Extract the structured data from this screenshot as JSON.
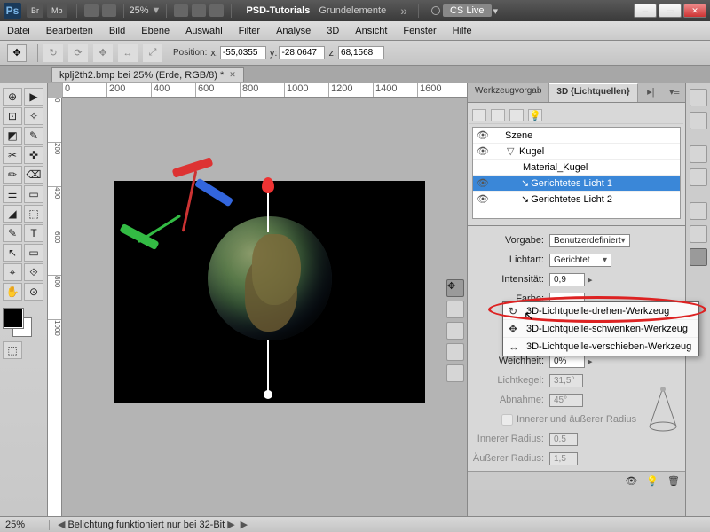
{
  "titlebar": {
    "logo": "Ps",
    "btn_br": "Br",
    "btn_mb": "Mb",
    "zoom": "25%",
    "workspace1": "PSD-Tutorials",
    "workspace2": "Grundelemente",
    "cslive": "CS Live"
  },
  "menu": [
    "Datei",
    "Bearbeiten",
    "Bild",
    "Ebene",
    "Auswahl",
    "Filter",
    "Analyse",
    "3D",
    "Ansicht",
    "Fenster",
    "Hilfe"
  ],
  "options": {
    "pos_label": "Position:",
    "x_lbl": "x:",
    "x_val": "-55,0355",
    "y_lbl": "y:",
    "y_val": "-28,0647",
    "z_lbl": "z:",
    "z_val": "68,1568"
  },
  "doc_tab": "kplj2th2.bmp bei 25% (Erde, RGB/8) *",
  "ruler_h": [
    "0",
    "200",
    "400",
    "600",
    "800",
    "1000",
    "1200",
    "1400",
    "1600"
  ],
  "ruler_v": [
    "0",
    "200",
    "400",
    "600",
    "800",
    "1000"
  ],
  "tools": [
    "⊕",
    "▶",
    "⊡",
    "✧",
    "◩",
    "✎",
    "✂",
    "✜",
    "✏",
    "⌫",
    "⚌",
    "▭",
    "◢",
    "⬚",
    "✎",
    "⌖",
    "⟐",
    "T",
    "↖",
    "▭",
    "✋",
    "⊙",
    "⬚",
    "Q"
  ],
  "panel": {
    "tab1": "Werkzeugvorgab",
    "tab2": "3D {Lichtquellen}",
    "scene_root": "Szene",
    "mesh": "Kugel",
    "material": "Material_Kugel",
    "light1": "Gerichtetes Licht 1",
    "light2": "Gerichtetes Licht 2"
  },
  "props": {
    "vorgabe_l": "Vorgabe:",
    "vorgabe_v": "Benutzerdefiniert",
    "lichtart_l": "Lichtart:",
    "lichtart_v": "Gerichtet",
    "intens_l": "Intensität:",
    "intens_v": "0,9",
    "farbe_l": "Farbe:",
    "weich_l": "Weichheit:",
    "weich_v": "0%",
    "kegel_l": "Lichtkegel:",
    "kegel_v": "31,5°",
    "abn_l": "Abnahme:",
    "abn_v": "45°",
    "radius_chk": "Innerer und äußerer Radius",
    "inner_l": "Innerer Radius:",
    "inner_v": "0,5",
    "outer_l": "Äußerer Radius:",
    "outer_v": "1,5"
  },
  "flyout": {
    "item1": "3D-Lichtquelle-drehen-Werkzeug",
    "item2": "3D-Lichtquelle-schwenken-Werkzeug",
    "item3": "3D-Lichtquelle-verschieben-Werkzeug"
  },
  "status": {
    "zoom": "25%",
    "msg": "Belichtung funktioniert nur bei 32-Bit"
  }
}
